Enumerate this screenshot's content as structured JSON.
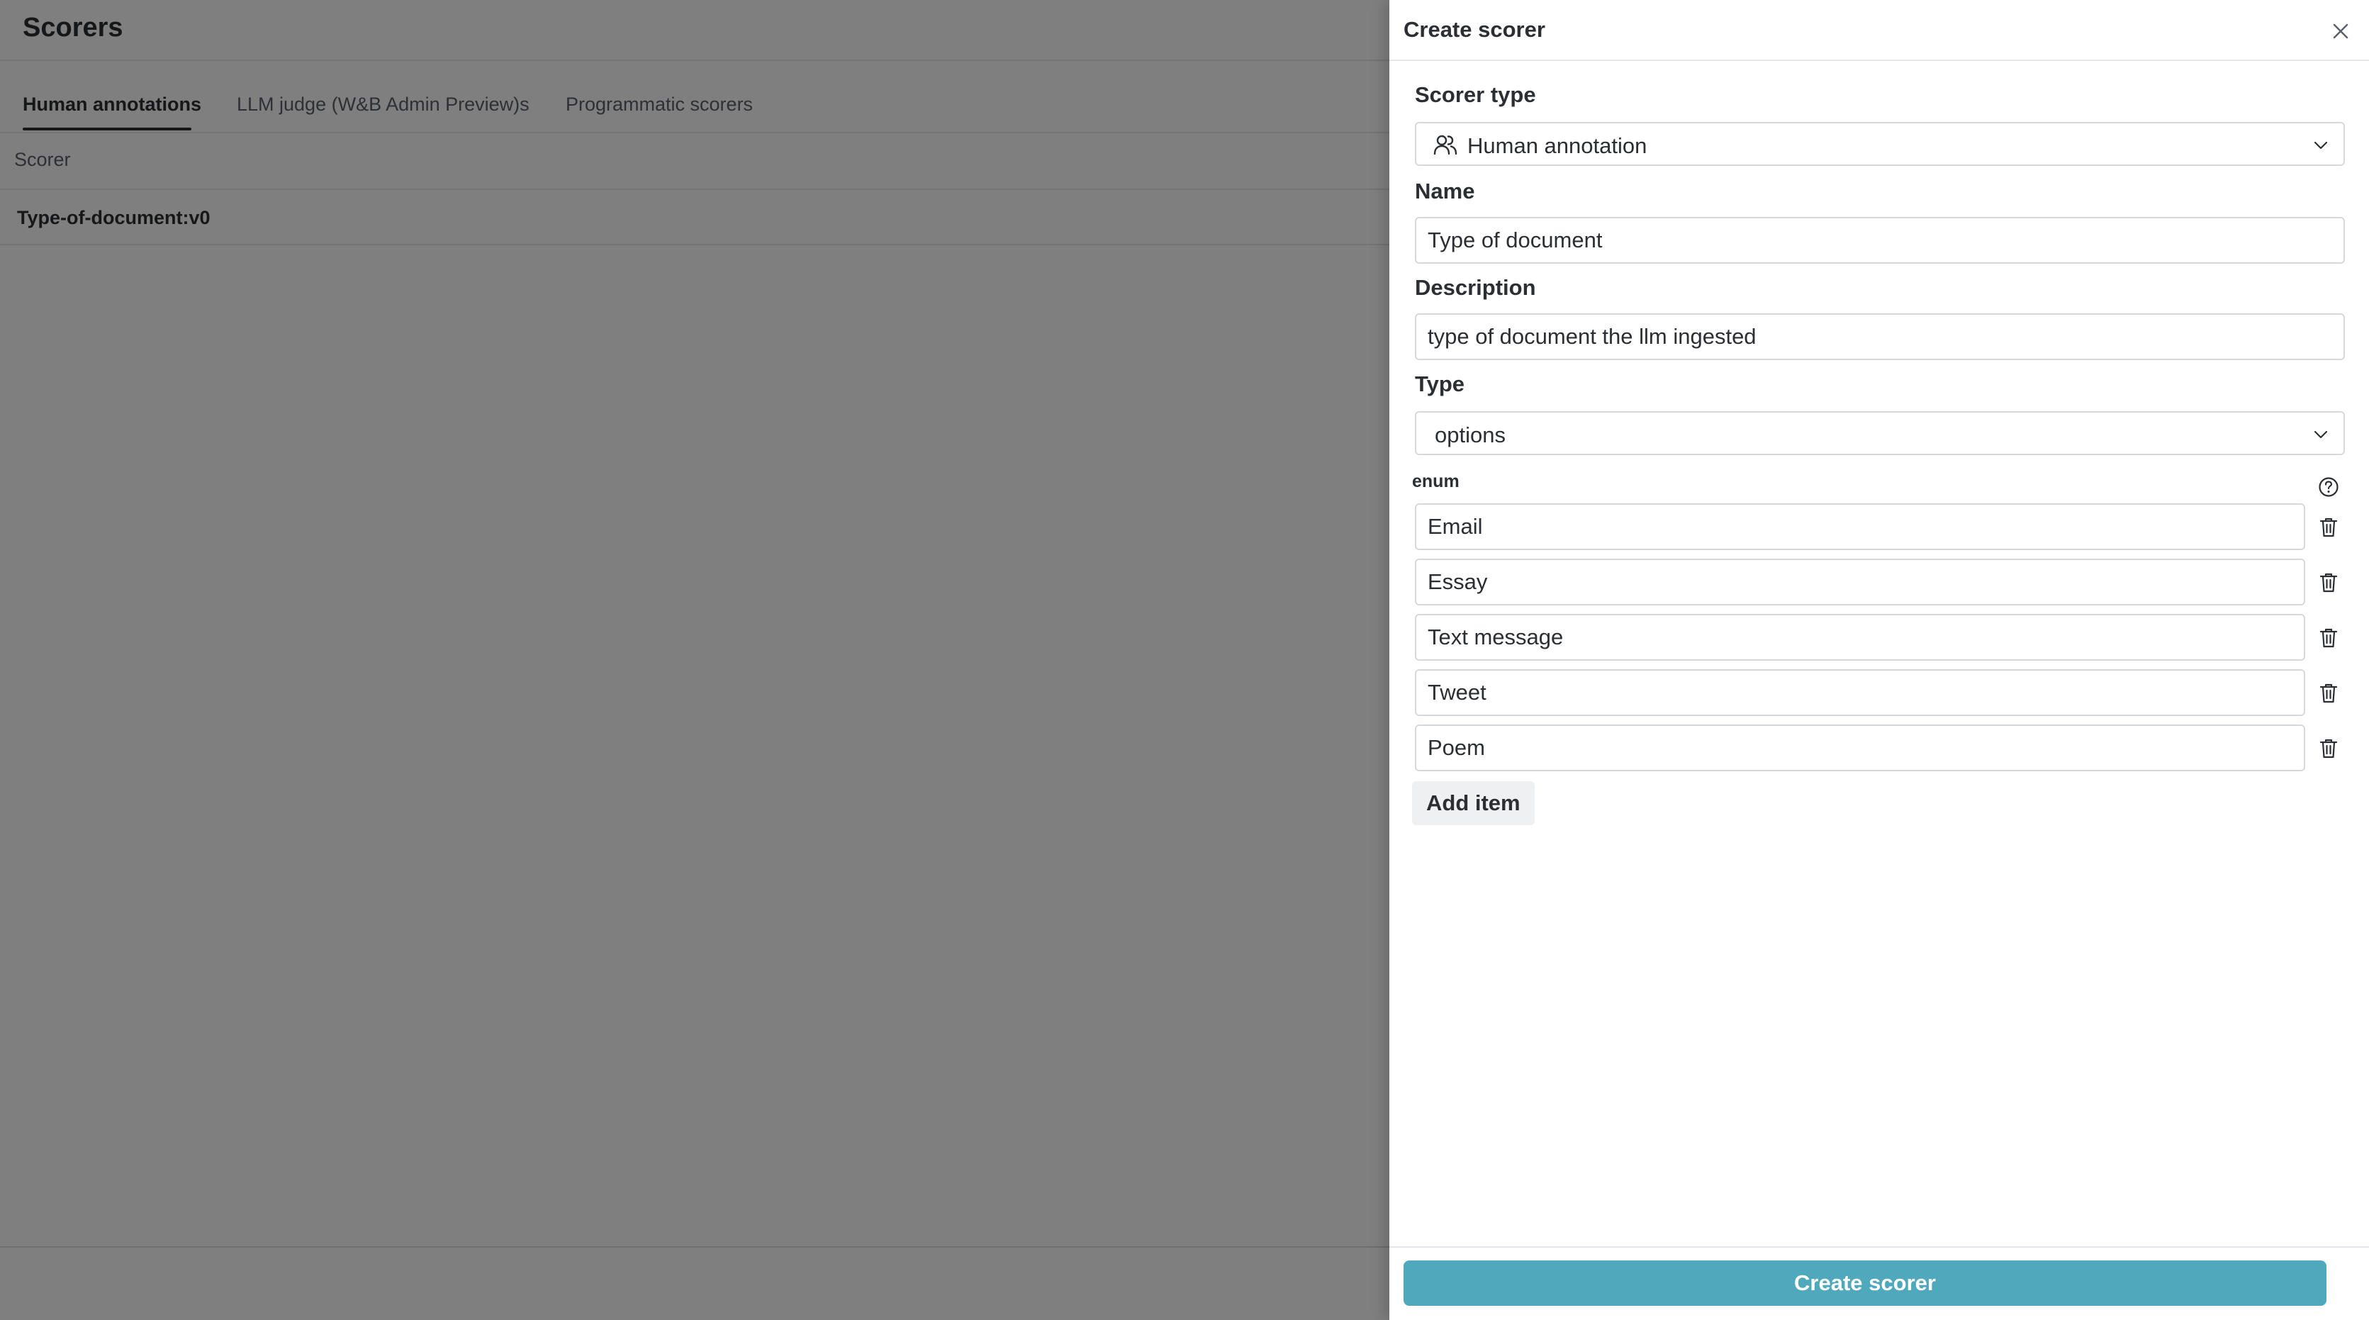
{
  "page": {
    "title": "Scorers",
    "tabs": [
      {
        "label": "Human annotations",
        "active": true
      },
      {
        "label": "LLM judge (W&B Admin Preview)s",
        "active": false
      },
      {
        "label": "Programmatic scorers",
        "active": false
      }
    ],
    "table": {
      "column_header": "Scorer",
      "rows": [
        "Type-of-document:v0"
      ]
    }
  },
  "drawer": {
    "title": "Create scorer",
    "close_icon": "close-icon",
    "scorer_type": {
      "label": "Scorer type",
      "value": "Human annotation",
      "icon": "users-icon"
    },
    "name": {
      "label": "Name",
      "value": "Type of document"
    },
    "description": {
      "label": "Description",
      "value": "type of document the llm ingested"
    },
    "type": {
      "label": "Type",
      "value": "options"
    },
    "enum": {
      "label": "enum",
      "items": [
        "Email",
        "Essay",
        "Text message",
        "Tweet",
        "Poem"
      ]
    },
    "add_item_label": "Add item",
    "submit_label": "Create scorer"
  },
  "colors": {
    "primary_button": "#4fa8bb",
    "overlay": "rgba(0,0,0,0.5)"
  }
}
